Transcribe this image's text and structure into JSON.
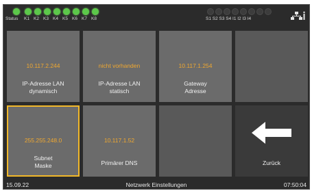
{
  "status_bar": {
    "status_label": "Status",
    "k_leds": [
      "K1",
      "K2",
      "K3",
      "K4",
      "K5",
      "K6",
      "K7",
      "K8"
    ],
    "s_labels": "S1 S2 S3 S4  I1  I2  I3  I4",
    "led_on_color": "#5cc84a",
    "network_icon": "network-status-icon"
  },
  "tiles": {
    "lan_dynamic": {
      "value": "10.117.2.244",
      "label": "IP-Adresse LAN\ndynamisch"
    },
    "lan_static": {
      "value": "nicht vorhanden",
      "label": "IP-Adresse LAN\nstatisch"
    },
    "gateway": {
      "value": "10.117.1.254",
      "label": "Gateway\nAdresse"
    },
    "subnet": {
      "value": "255.255.248.0",
      "label": "Subnet\nMaske"
    },
    "dns": {
      "value": "10.117.1.52",
      "label": "Primärer DNS"
    },
    "back": {
      "label": "Zurück",
      "icon": "arrow-left-icon"
    }
  },
  "bottom_bar": {
    "date": "15.09.22",
    "title": "Netzwerk Einstellungen",
    "time": "07:50:04"
  },
  "colors": {
    "value_text": "#f0a830",
    "selection_border": "#f2b829",
    "background": "#2b2b2b"
  }
}
